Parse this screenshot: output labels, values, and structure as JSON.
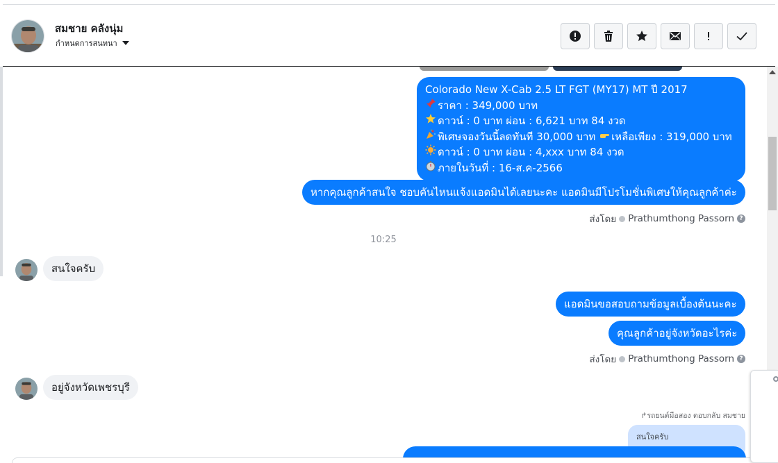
{
  "contact": {
    "name": "สมชาย คลังนุ่ม",
    "subtitle": "กำหนดการสนทนา"
  },
  "toolbar": {
    "buttons": [
      {
        "icon": "alert-circle-icon"
      },
      {
        "icon": "trash-icon"
      },
      {
        "icon": "star-icon"
      },
      {
        "icon": "envelope-icon"
      },
      {
        "icon": "exclamation-icon",
        "label": "!"
      },
      {
        "icon": "checkmark-icon"
      }
    ]
  },
  "messages": {
    "car_offer": {
      "title": "Colorado New X-Cab 2.5 LT FGT (MY17) MT ปี 2017",
      "price": "ราคา : 349,000 บาท",
      "down1": "ดาวน์ : 0 บาท ผ่อน : 6,621 บาท 84 งวด",
      "special": "พิเศษจองวันนี้ลดทันที 30,000 บาท",
      "remaining": "เหลือเพียง : 319,000 บาท",
      "down2": "ดาวน์ : 0 บาท ผ่อน : 4,xxx บาท 84 งวด",
      "deadline": "ภายในวันที่ : 16-ส.ค-2566"
    },
    "invite": "หากคุณลูกค้าสนใจ ชอบคันไหนแจ้งแอดมินได้เลยนะคะ แอดมินมีโปรโมชั่นพิเศษให้คุณลูกค้าค่ะ",
    "sent_by_label": "ส่งโดย",
    "sent_by_name": "Prathumthong Passorn",
    "time": "10:25",
    "customer_1": "สนใจครับ",
    "admin_ask_1": "แอดมินขอสอบถามข้อมูลเบื้องต้นนะคะ",
    "admin_ask_2": "คุณลูกค้าอยู่จังหวัดอะไรค่ะ",
    "customer_2": "อยู่จังหวัดเพชรบุรี",
    "reply_note": "รถยนต์มือสอง ตอบกลับ สมชาย",
    "reply_quote": "สนใจครับ"
  },
  "colors": {
    "outgoing_bubble": "#0a7cff",
    "incoming_bubble": "#f0f2f5"
  }
}
